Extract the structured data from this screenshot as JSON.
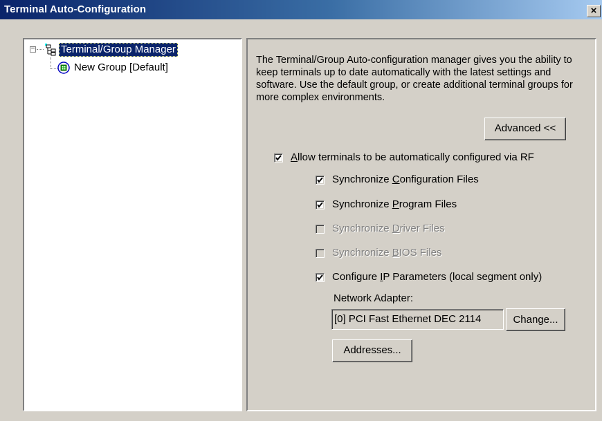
{
  "window": {
    "title": "Terminal Auto-Configuration",
    "close_glyph": "×"
  },
  "tree": {
    "root": {
      "label": "Terminal/Group Manager",
      "icon": "tree-hierarchy-icon",
      "expander": "−"
    },
    "children": [
      {
        "label": "New Group [Default]",
        "icon": "terminal-group-icon"
      }
    ]
  },
  "description": "The Terminal/Group Auto-configuration manager gives you the ability to keep terminals up to date automatically with the latest settings and software.  Use the default group, or create additional terminal groups for more complex environments.",
  "buttons": {
    "advanced": "Advanced <<",
    "change": "Change...",
    "addresses": "Addresses..."
  },
  "options": {
    "allow_rf": {
      "pre": "",
      "accel": "A",
      "post": "llow terminals to be automatically configured via RF",
      "checked": true,
      "enabled": true
    },
    "sync_config": {
      "pre": "Synchronize ",
      "accel": "C",
      "post": "onfiguration Files",
      "checked": true,
      "enabled": true
    },
    "sync_program": {
      "pre": "Synchronize ",
      "accel": "P",
      "post": "rogram Files",
      "checked": true,
      "enabled": true
    },
    "sync_driver": {
      "pre": "Synchronize ",
      "accel": "D",
      "post": "river Files",
      "checked": false,
      "enabled": false
    },
    "sync_bios": {
      "pre": "Synchronize ",
      "accel": "B",
      "post": "IOS Files",
      "checked": false,
      "enabled": false
    },
    "configure_ip": {
      "pre": "Configure ",
      "accel": "I",
      "post": "P Parameters (local segment only)",
      "checked": true,
      "enabled": true
    }
  },
  "network_adapter": {
    "caption": "Network Adapter:",
    "value": "[0] PCI Fast Ethernet DEC 2114"
  },
  "colors": {
    "title_start": "#0a246a",
    "title_end": "#a6caf0",
    "face": "#d4d0c8",
    "selection": "#0a246a"
  }
}
